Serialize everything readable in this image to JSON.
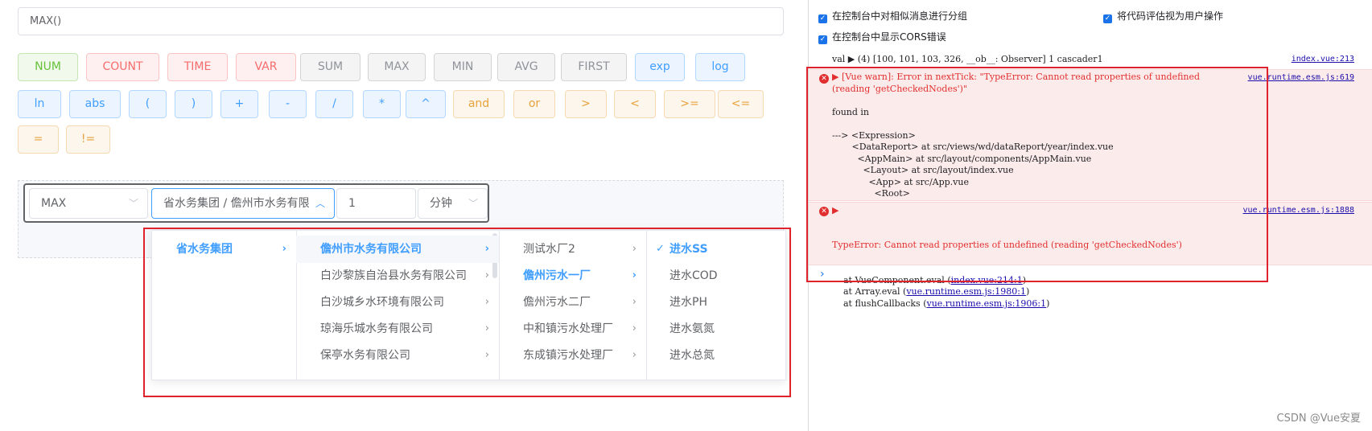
{
  "formula": {
    "value": "MAX()"
  },
  "function_buttons": [
    {
      "label": "NUM",
      "style": "success"
    },
    {
      "label": "COUNT",
      "style": "danger"
    },
    {
      "label": "TIME",
      "style": "danger"
    },
    {
      "label": "VAR",
      "style": "danger"
    },
    {
      "label": "SUM",
      "style": "info"
    },
    {
      "label": "MAX",
      "style": "info"
    },
    {
      "label": "MIN",
      "style": "info"
    },
    {
      "label": "AVG",
      "style": "info"
    },
    {
      "label": "FIRST",
      "style": "info"
    },
    {
      "label": "exp",
      "style": "primary"
    },
    {
      "label": "log",
      "style": "primary"
    }
  ],
  "operator_buttons": [
    {
      "label": "ln",
      "style": "primary"
    },
    {
      "label": "abs",
      "style": "primary"
    },
    {
      "label": "(",
      "style": "primary"
    },
    {
      "label": ")",
      "style": "primary"
    },
    {
      "label": "+",
      "style": "primary"
    },
    {
      "label": "-",
      "style": "primary"
    },
    {
      "label": "/",
      "style": "primary"
    },
    {
      "label": "*",
      "style": "primary"
    },
    {
      "label": "^",
      "style": "primary"
    },
    {
      "label": "and",
      "style": "warning"
    },
    {
      "label": "or",
      "style": "warning"
    },
    {
      "label": ">",
      "style": "warning"
    },
    {
      "label": "<",
      "style": "warning"
    },
    {
      "label": ">=",
      "style": "warning"
    },
    {
      "label": "<=",
      "style": "warning"
    }
  ],
  "compare_buttons": [
    {
      "label": "=",
      "style": "warning"
    },
    {
      "label": "!=",
      "style": "warning"
    }
  ],
  "controls": {
    "function_select": "MAX",
    "cascader_value": "省水务集团 / 儋州市水务有限",
    "number_input": "1",
    "unit_select": "分钟",
    "colors": {
      "primary": "#409eff",
      "annotation_box": "#e0222c"
    }
  },
  "cascader": {
    "columns": [
      {
        "items": [
          {
            "label": "省水务集团",
            "active": true,
            "has_children": true
          }
        ]
      },
      {
        "items": [
          {
            "label": "儋州市水务有限公司",
            "active": true,
            "has_children": true
          },
          {
            "label": "白沙黎族自治县水务有限公司",
            "active": false,
            "has_children": true
          },
          {
            "label": "白沙城乡水环境有限公司",
            "active": false,
            "has_children": true
          },
          {
            "label": "琼海乐城水务有限公司",
            "active": false,
            "has_children": true
          },
          {
            "label": "保亭水务有限公司",
            "active": false,
            "has_children": true
          }
        ]
      },
      {
        "items": [
          {
            "label": "测试水厂2",
            "active": false,
            "has_children": true
          },
          {
            "label": "儋州污水一厂",
            "active": true,
            "has_children": true
          },
          {
            "label": "儋州污水二厂",
            "active": false,
            "has_children": true
          },
          {
            "label": "中和镇污水处理厂",
            "active": false,
            "has_children": true
          },
          {
            "label": "东成镇污水处理厂",
            "active": false,
            "has_children": true
          }
        ]
      },
      {
        "items": [
          {
            "label": "进水SS",
            "active": true,
            "checked": true
          },
          {
            "label": "进水COD",
            "active": false
          },
          {
            "label": "进水PH",
            "active": false
          },
          {
            "label": "进水氨氮",
            "active": false
          },
          {
            "label": "进水总氮",
            "active": false
          }
        ]
      }
    ]
  },
  "devtools": {
    "settings": {
      "group_similar": "在控制台中对相似消息进行分组",
      "treat_as_user": "将代码评估视为用户操作",
      "show_cors": "在控制台中显示CORS错误"
    },
    "log": {
      "text": "val ▶ (4) [100, 101, 103, 326, __ob__: Observer] 1 cascader1",
      "source": "index.vue:213"
    },
    "error1": {
      "lines": [
        "▶ [Vue warn]: Error in nextTick: \"TypeError: Cannot read properties of undefined",
        "(reading 'getCheckedNodes')\"",
        "",
        "found in",
        "",
        "---> <Expression>",
        "       <DataReport> at src/views/wd/dataReport/year/index.vue",
        "         <AppMain> at src/layout/components/AppMain.vue",
        "           <Layout> at src/layout/index.vue",
        "             <App> at src/App.vue",
        "               <Root>"
      ],
      "source": "vue.runtime.esm.js:619"
    },
    "error2": {
      "toggle": "▶",
      "message": "TypeError: Cannot read properties of undefined (reading 'getCheckedNodes')",
      "frames": [
        {
          "prefix": "    at VueComponent.eval (",
          "link": "index.vue:214:1",
          "suffix": ")"
        },
        {
          "prefix": "    at Array.eval (",
          "link": "vue.runtime.esm.js:1980:1",
          "suffix": ")"
        },
        {
          "prefix": "    at flushCallbacks (",
          "link": "vue.runtime.esm.js:1906:1",
          "suffix": ")"
        }
      ],
      "source": "vue.runtime.esm.js:1888"
    },
    "prompt": "›"
  },
  "watermark": "CSDN @Vue安夏"
}
